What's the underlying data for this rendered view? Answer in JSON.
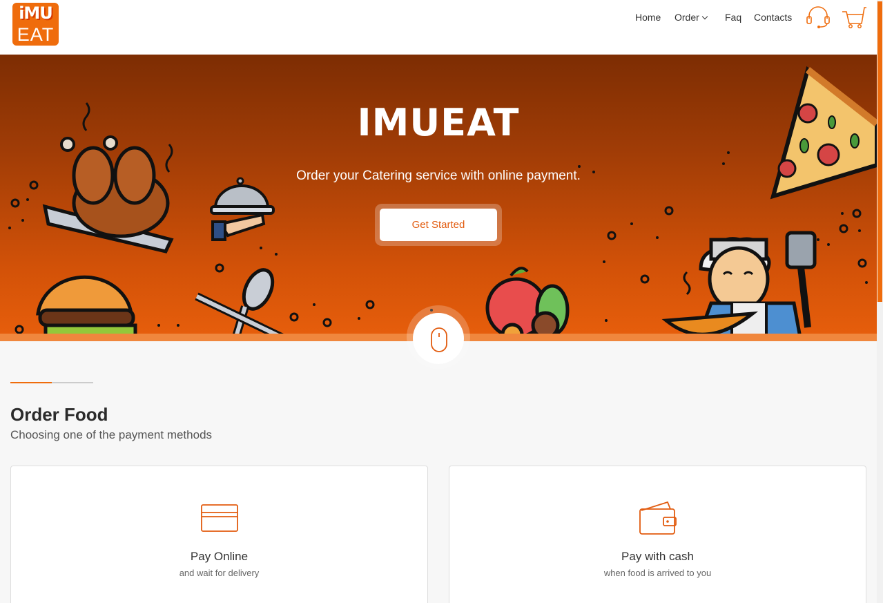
{
  "brand": {
    "logo_top": "iMU",
    "logo_bottom": "EAT",
    "accent": "#ef6c0c"
  },
  "nav": {
    "home": "Home",
    "order": "Order",
    "faq": "Faq",
    "contacts": "Contacts"
  },
  "icons": {
    "support": "headset-icon",
    "cart": "cart-icon",
    "scroll": "mouse-icon",
    "card": "credit-card-icon",
    "wallet": "wallet-icon"
  },
  "hero": {
    "title": "IMUEAT",
    "subtitle": "Order your Catering service with online payment.",
    "cta": "Get Started"
  },
  "section": {
    "title": "Order Food",
    "subtitle": "Choosing one of the payment methods"
  },
  "cards": [
    {
      "title": "Pay Online",
      "desc": "and wait for delivery"
    },
    {
      "title": "Pay with cash",
      "desc": "when food is arrived to you"
    }
  ]
}
